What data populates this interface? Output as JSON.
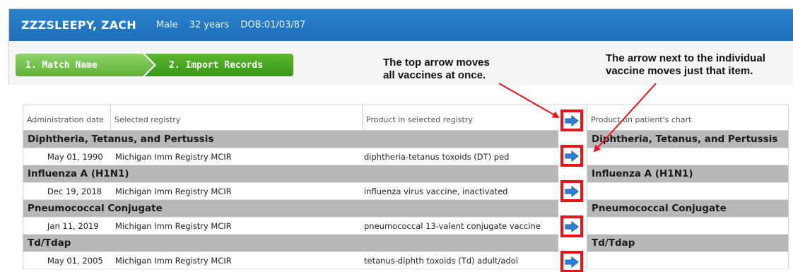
{
  "patient": {
    "name": "ZZZSLEEPY, ZACH",
    "sex": "Male",
    "age": "32 years",
    "dob": "DOB:01/03/87"
  },
  "wizard": {
    "steps": [
      {
        "label": "1. Match Name",
        "state": "completed"
      },
      {
        "label": "2. Import Records",
        "state": "active"
      }
    ]
  },
  "callouts": {
    "left_line1": "The top arrow moves",
    "left_line2": "all vaccines at once.",
    "right_line1": "The arrow next to the individual",
    "right_line2": "vaccine moves just that item."
  },
  "grid": {
    "columns": {
      "admin_date": "Administration date",
      "registry": "Selected registry",
      "product_registry": "Product in selected registry",
      "product_chart": "Product on patient's chart"
    },
    "groups": [
      {
        "name": "Diphtheria, Tetanus, and Pertussis",
        "chart_name": "Diphtheria, Tetanus, and Pertussis",
        "record": {
          "date": "May 01, 1990",
          "registry": "Michigan Imm Registry MCIR",
          "product": "diphtheria-tetanus toxoids (DT) ped"
        }
      },
      {
        "name": "Influenza A (H1N1)",
        "chart_name": "Influenza A (H1N1)",
        "record": {
          "date": "Dec 19, 2018",
          "registry": "Michigan Imm Registry MCIR",
          "product": "influenza virus vaccine, inactivated"
        }
      },
      {
        "name": "Pneumococcal Conjugate",
        "chart_name": "Pneumococcal Conjugate",
        "record": {
          "date": "Jan 11, 2019",
          "registry": "Michigan Imm Registry MCIR",
          "product": "pneumococcal 13-valent conjugate vaccine"
        }
      },
      {
        "name": "Td/Tdap",
        "chart_name": "Td/Tdap",
        "record": {
          "date": "May 01, 2005",
          "registry": "Michigan Imm Registry MCIR",
          "product": "tetanus-diphth toxoids (Td) adult/adol"
        }
      }
    ]
  },
  "colors": {
    "header_blue": "#1e6fb8",
    "step_green": "#4aa623",
    "group_gray": "#b8b8b8",
    "highlight_red": "#e8141a",
    "arrow_blue": "#2f7fd6"
  },
  "icons": {
    "move_arrow": "right-arrow-icon"
  }
}
